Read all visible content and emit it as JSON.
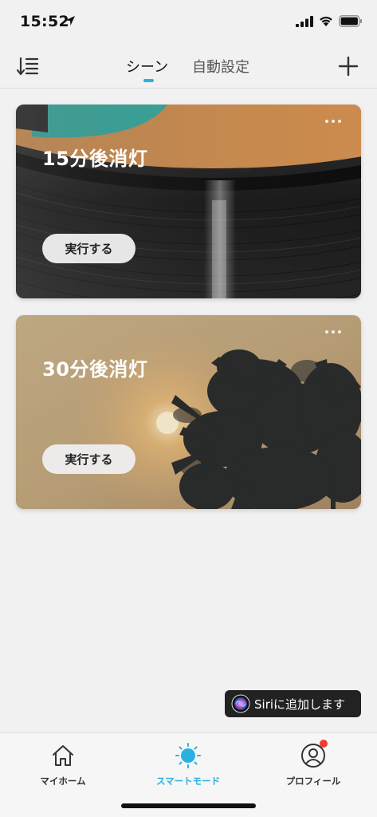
{
  "status_bar": {
    "time": "15:52"
  },
  "nav": {
    "tabs": [
      {
        "label": "シーン",
        "active": true
      },
      {
        "label": "自動設定",
        "active": false
      }
    ],
    "accent_color": "#2ab1e0"
  },
  "scenes": [
    {
      "title": "15分後消灯",
      "button_label": "実行する",
      "image": "vinyl-record"
    },
    {
      "title": "30分後消灯",
      "button_label": "実行する",
      "image": "palm-sunset"
    }
  ],
  "siri": {
    "label": "Siriに追加します"
  },
  "tab_bar": {
    "items": [
      {
        "label": "マイホーム",
        "icon": "home-icon",
        "active": false
      },
      {
        "label": "スマートモード",
        "icon": "sun-icon",
        "active": true
      },
      {
        "label": "プロフィール",
        "icon": "profile-icon",
        "active": false,
        "badge": true
      }
    ]
  }
}
